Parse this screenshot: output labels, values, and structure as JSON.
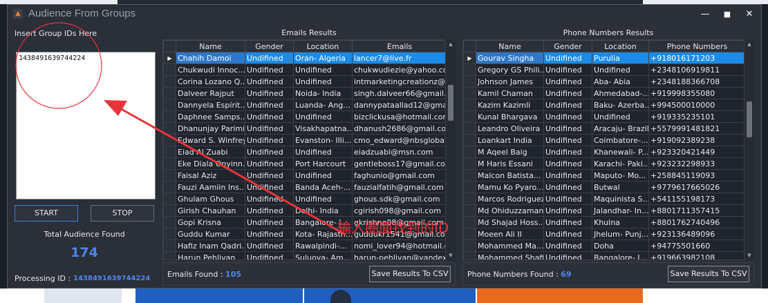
{
  "window": {
    "title": "Audience From Groups",
    "icon": "app-logo-icon"
  },
  "controls": {
    "minimize": "—",
    "maximize": "■",
    "close": "✕"
  },
  "left": {
    "insert_label": "Insert Group IDs Here",
    "group_ids": "1438491639744224",
    "start_label": "START",
    "stop_label": "STOP",
    "total_label": "Total Audience Found",
    "total_count": "174",
    "processing_label": "Processing ID :",
    "processing_id": "1438491639744224"
  },
  "emails": {
    "title": "Emails Results",
    "columns": [
      "Name",
      "Gender",
      "Location",
      "Emails"
    ],
    "rows": [
      [
        "Chahih Damoi",
        "Undifined",
        "Oran- Algeria",
        "lancer7@live.fr"
      ],
      [
        "Chukwudi Innoc...",
        "Undifined",
        "Undifined",
        "chukwudiezie@yahoo.com"
      ],
      [
        "Corina Lozano Q...",
        "Undifined",
        "Undifined",
        "intmarketingcreationz@..."
      ],
      [
        "Dalveer Rajput",
        "Undifined",
        "Noida- India",
        "singh.dalveer66@gmail.c..."
      ],
      [
        "Dannyela Espírit...",
        "Undifined",
        "Luanda- Ang...",
        "dannypataallad12@gmai..."
      ],
      [
        "Daphnee Samps...",
        "Undifined",
        "Undifined",
        "bizclickusa@hotmail.com"
      ],
      [
        "Dhanunjay Parimi",
        "Undifined",
        "Visakhapatna...",
        "dhanush2686@gmail.com"
      ],
      [
        "Edward S. Winfrey",
        "Undifined",
        "Evanston- Illi...",
        "cmo_edward@nbsglobal...."
      ],
      [
        "Eiad Al Zuabi",
        "Undifined",
        "Undifined",
        "eiadzuabi@msn.com"
      ],
      [
        "Eke Diala Onyinn...",
        "Undifined",
        "Port Harcourt",
        "gentleboss17@gmail.com"
      ],
      [
        "Faisal Aziz",
        "Undifined",
        "Undifined",
        "faghunio@gmail.com"
      ],
      [
        "Fauzi Aamiin Ins...",
        "Undifined",
        "Banda Aceh-...",
        "fauzialfatih@gmail.com"
      ],
      [
        "Ghulam Ghous",
        "Undifined",
        "Undifined",
        "ghous.sdk@gmail.com"
      ],
      [
        "Girish Chauhan",
        "Undifined",
        "Delhi- India",
        "cgirish098@gmail.com"
      ],
      [
        "Gopi Krisna",
        "Undifined",
        "Bangalore- I...",
        "gkrishna08@gmail.com"
      ],
      [
        "Guddu Kumar",
        "Undifined",
        "Kota- Rajasth...",
        "guddukr1541@gmail.com"
      ],
      [
        "Hafiz Inam Qadri...",
        "Undifined",
        "Rawalpindi-...",
        "nomi_lover94@hotmail.c..."
      ],
      [
        "Harun Pehlivan",
        "Undifined",
        "Suluova- Am...",
        "harun-pehlivan@yandex..."
      ]
    ],
    "found_label": "Emails Found :",
    "found_count": "105",
    "save_label": "Save Results To CSV"
  },
  "phones": {
    "title": "Phone Numbers Results",
    "columns": [
      "Name",
      "Gender",
      "Location",
      "Phone Numbers"
    ],
    "rows": [
      [
        "Gourav Singha",
        "Undifined",
        "Purulia",
        "+918016171203"
      ],
      [
        "Gregory GS Phili...",
        "Undifined",
        "Undifined",
        "+2348106919811"
      ],
      [
        "Johnson James",
        "Undifined",
        "Aba- Abia",
        "+2348188366708"
      ],
      [
        "Kamil Chaman",
        "Undifined",
        "Ahmedabad-...",
        "+919998355080"
      ],
      [
        "Kazim  Kazimli",
        "Undifined",
        "Baku- Azerba...",
        "+994500010000"
      ],
      [
        "Kunal Bhargava",
        "Undifined",
        "Undifined",
        "+919335235101"
      ],
      [
        "Leandro Oliveira",
        "Undifined",
        "Aracaju- Brazil",
        "+5579991481821"
      ],
      [
        "Loankart India",
        "Undifined",
        "Coimbatore-...",
        "+919092389238"
      ],
      [
        "M Aqeel Baig",
        "Undifined",
        "Khanewali- P...",
        "+923320421449"
      ],
      [
        "M Haris Essani",
        "Undifined",
        "Karachi- Paki...",
        "+923232298933"
      ],
      [
        "Malcon Batista...",
        "Undifined",
        "Maputo- Mo...",
        "+258845119093"
      ],
      [
        "Mamu Ko Pyaro...",
        "Undifined",
        "Butwal",
        "+9779617665026"
      ],
      [
        "Marcos Rodriguez",
        "Undifined",
        "Maquinista S...",
        "+541155198173"
      ],
      [
        "Md Ohiduzzaman",
        "Undifined",
        "Jalandhar- In...",
        "+8801711357415"
      ],
      [
        "Md Shajad Hoss...",
        "Undifined",
        "Khulna",
        "+8801762740496"
      ],
      [
        "Moeen Ali II",
        "Undifined",
        "Jhelum- Punj...",
        "+923136489096"
      ],
      [
        "Mohammed Ma...",
        "Undifined",
        "Doha",
        "+94775501660"
      ],
      [
        "Mohammed Shaffi",
        "Undifined",
        "Bangalore- I...",
        "+919663982108"
      ]
    ],
    "found_label": "Phone Numbers Found :",
    "found_count": "69",
    "save_label": "Save Results To CSV"
  },
  "annotation": {
    "text": "输入圈面找到的ID",
    "color": "#e8343a"
  },
  "colors": {
    "accent": "#4f86f0",
    "selection": "#1c8be8",
    "window_bg": "#2a2f38"
  }
}
